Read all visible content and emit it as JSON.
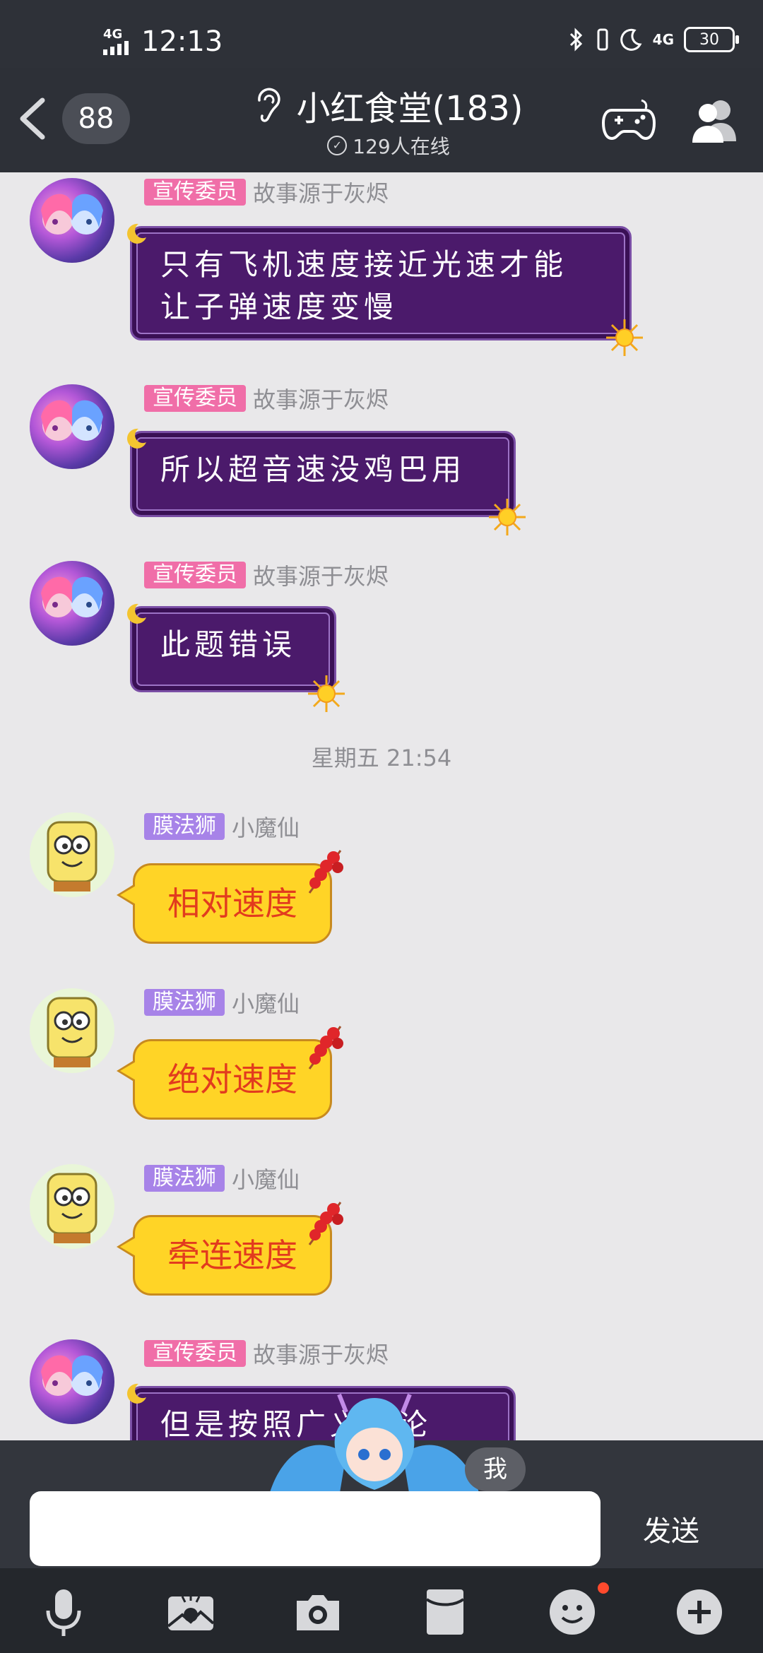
{
  "status_bar": {
    "network": "4G",
    "time": "12:13",
    "network_right": "4G",
    "battery": "30"
  },
  "header": {
    "unread_count": "88",
    "title": "小红食堂(183)",
    "online": "129人在线"
  },
  "messages": [
    {
      "tag": "宣传委员",
      "nick": "故事源于灰烬",
      "lines": [
        "只有飞机速度接近光速才能",
        "让子弹速度变慢"
      ]
    },
    {
      "tag": "宣传委员",
      "nick": "故事源于灰烬",
      "lines": [
        "所以超音速没鸡巴用"
      ]
    },
    {
      "tag": "宣传委员",
      "nick": "故事源于灰烬",
      "lines": [
        "此题错误"
      ]
    },
    {
      "tag": "膜法狮",
      "nick": "小魔仙",
      "lines": [
        "相对速度"
      ]
    },
    {
      "tag": "膜法狮",
      "nick": "小魔仙",
      "lines": [
        "绝对速度"
      ]
    },
    {
      "tag": "膜法狮",
      "nick": "小魔仙",
      "lines": [
        "牵连速度"
      ]
    },
    {
      "tag": "宣传委员",
      "nick": "故事源于灰烬",
      "lines": [
        "但是按照广义讨论"
      ]
    }
  ],
  "time_divider": "星期五 21:54",
  "input_bar": {
    "input_value": "",
    "send_label": "发送",
    "me_label": "我"
  },
  "bottom_icons": [
    "microphone-icon",
    "picture-icon",
    "camera-icon",
    "red-packet-icon",
    "emoji-icon",
    "plus-icon"
  ],
  "colors": {
    "header_bg": "#2d3037",
    "chat_bg": "#e9e8ea",
    "tag_pink": "#f06ea8",
    "tag_violet": "#a783e8",
    "bubble_purple": "#4b1a6b",
    "bubble_yellow": "#ffd426",
    "yellow_text": "#e23b1e"
  }
}
